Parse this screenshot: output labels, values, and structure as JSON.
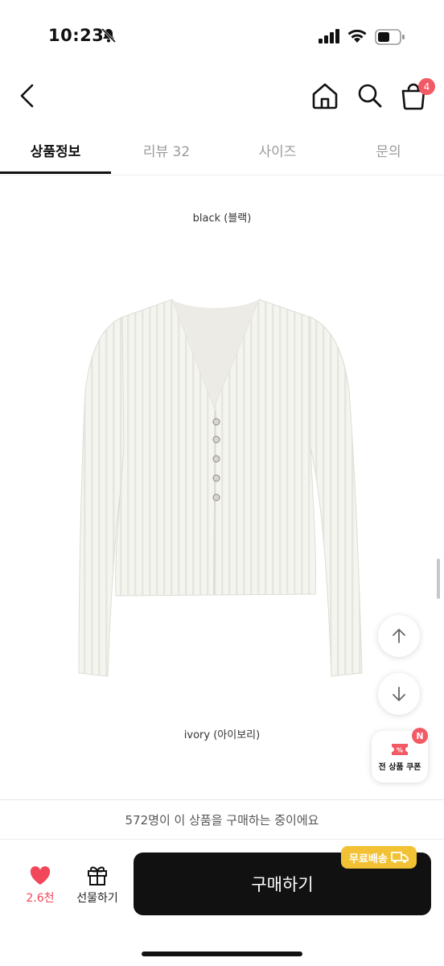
{
  "status_bar": {
    "time": "10:23"
  },
  "header": {
    "cart_badge": "4"
  },
  "tabs": [
    {
      "label": "상품정보",
      "active": true
    },
    {
      "label": "리뷰 32",
      "active": false
    },
    {
      "label": "사이즈",
      "active": false
    },
    {
      "label": "문의",
      "active": false
    }
  ],
  "content": {
    "caption_top": "black (블랙)",
    "caption_bottom": "ivory (아이보리)"
  },
  "floating": {
    "coupon_label": "전 상품 쿠폰",
    "coupon_badge": "N"
  },
  "notice": "572명이 이 상품을 구매하는 중이에요",
  "bottom_bar": {
    "like_count": "2.6천",
    "gift_label": "선물하기",
    "buy_label": "구매하기",
    "shipping_badge": "무료배송"
  },
  "colors": {
    "accent_red": "#f25a65",
    "buy_button": "#111111",
    "shipping_yellow": "#f3c234"
  }
}
